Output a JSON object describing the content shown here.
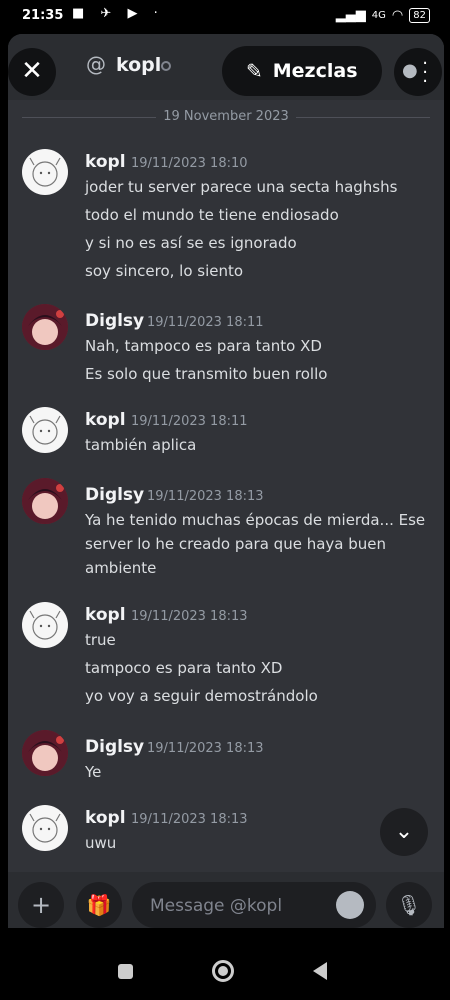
{
  "status_bar": {
    "time": "21:35",
    "icons": "■ ✈ ▶ ·",
    "network": "4G",
    "battery": "82"
  },
  "header": {
    "close_glyph": "✕",
    "at_symbol": "@",
    "channel_name": "kopl",
    "mezclas_label": "Mezclas"
  },
  "date_separator": "19 November 2023",
  "messages": [
    {
      "author": "kopl",
      "timestamp": "19/11/2023 18:10",
      "lines": [
        "joder tu server parece una secta haghshs",
        "todo el mundo te tiene endiosado",
        "y si no es así se es ignorado",
        "soy sincero, lo siento"
      ]
    },
    {
      "author": "Diglsy",
      "timestamp": "19/11/2023 18:11",
      "lines": [
        "Nah, tampoco es para tanto XD",
        "Es solo que transmito buen rollo"
      ]
    },
    {
      "author": "kopl",
      "timestamp": "19/11/2023 18:11",
      "lines": [
        "también aplica"
      ]
    },
    {
      "author": "Diglsy",
      "timestamp": "19/11/2023 18:13",
      "lines": [
        "Ya he tenido muchas épocas de mierda... Ese",
        "server lo he creado para que haya buen",
        "ambiente"
      ]
    },
    {
      "author": "kopl",
      "timestamp": "19/11/2023 18:13",
      "lines": [
        "true",
        "tampoco es para tanto XD",
        "yo voy a seguir demostrándolo"
      ]
    },
    {
      "author": "Diglsy",
      "timestamp": "19/11/2023 18:13",
      "lines": [
        "Ye"
      ]
    },
    {
      "author": "kopl",
      "timestamp": "19/11/2023 18:13",
      "lines": [
        "uwu"
      ]
    }
  ],
  "composer": {
    "placeholder": "Message @kopl",
    "add_glyph": "+",
    "gift_glyph": "🎁",
    "mic_glyph": "🎙"
  },
  "scroll_down_glyph": "⌄",
  "colors": {
    "background": "#313338",
    "header": "#2b2d31",
    "text": "#dbdee1",
    "muted": "#949ba4",
    "button": "#1e1f22"
  }
}
